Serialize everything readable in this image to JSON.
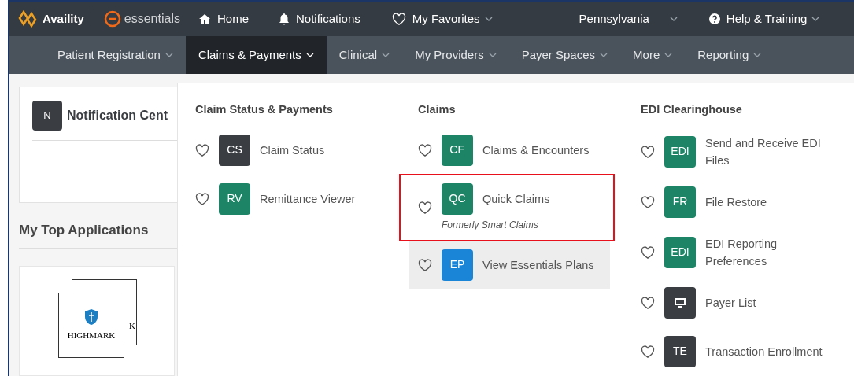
{
  "header": {
    "brand": "Availity",
    "product": "essentials",
    "links": [
      {
        "kind": "home",
        "label": "Home",
        "caret": false
      },
      {
        "kind": "bell",
        "label": "Notifications",
        "caret": false
      },
      {
        "kind": "heart",
        "label": "My Favorites",
        "caret": true
      }
    ],
    "region": {
      "label": "Pennsylvania"
    },
    "help": {
      "label": "Help & Training"
    }
  },
  "nav": [
    {
      "label": "Patient Registration",
      "selected": false
    },
    {
      "label": "Claims & Payments",
      "selected": true
    },
    {
      "label": "Clinical",
      "selected": false
    },
    {
      "label": "My Providers",
      "selected": false
    },
    {
      "label": "Payer Spaces",
      "selected": false
    },
    {
      "label": "More",
      "selected": false
    },
    {
      "label": "Reporting",
      "selected": false
    }
  ],
  "notification_card": {
    "badge": "N",
    "title": "Notification Cent"
  },
  "top_applications": {
    "title": "My Top Applications",
    "tiles": [
      {
        "label": "K"
      },
      {
        "label": "HIGHMARK"
      }
    ]
  },
  "menu": {
    "columns": [
      {
        "heading": "Claim Status & Payments",
        "items": [
          {
            "kind": "text",
            "tile": "CS",
            "color": "#3a3d42",
            "label": "Claim Status",
            "highlighted": false,
            "outlined": false
          },
          {
            "kind": "text",
            "tile": "RV",
            "color": "#1d8466",
            "label": "Remittance Viewer",
            "highlighted": false,
            "outlined": false
          }
        ]
      },
      {
        "heading": "Claims",
        "items": [
          {
            "kind": "text",
            "tile": "CE",
            "color": "#1d8466",
            "label": "Claims & Encounters",
            "highlighted": false,
            "outlined": false
          },
          {
            "kind": "text",
            "tile": "QC",
            "color": "#1d8466",
            "label": "Quick Claims",
            "note": "Formerly Smart Claims",
            "highlighted": false,
            "outlined": true
          },
          {
            "kind": "text",
            "tile": "EP",
            "color": "#1a85d6",
            "label": "View Essentials Plans",
            "highlighted": true,
            "outlined": false
          }
        ]
      },
      {
        "heading": "EDI Clearinghouse",
        "items": [
          {
            "kind": "text",
            "tile": "EDI",
            "color": "#1d8466",
            "label": "Send and Receive EDI Files",
            "highlighted": false,
            "outlined": false
          },
          {
            "kind": "text",
            "tile": "FR",
            "color": "#1d8466",
            "label": "File Restore",
            "highlighted": false,
            "outlined": false
          },
          {
            "kind": "text",
            "tile": "EDI",
            "color": "#1d8466",
            "label": "EDI Reporting Preferences",
            "highlighted": false,
            "outlined": false
          },
          {
            "kind": "icon",
            "color": "#3a3d42",
            "label": "Payer List",
            "highlighted": false,
            "outlined": false
          },
          {
            "kind": "text",
            "tile": "TE",
            "color": "#3a3d42",
            "label": "Transaction Enrollment",
            "highlighted": false,
            "outlined": false
          }
        ]
      }
    ]
  }
}
